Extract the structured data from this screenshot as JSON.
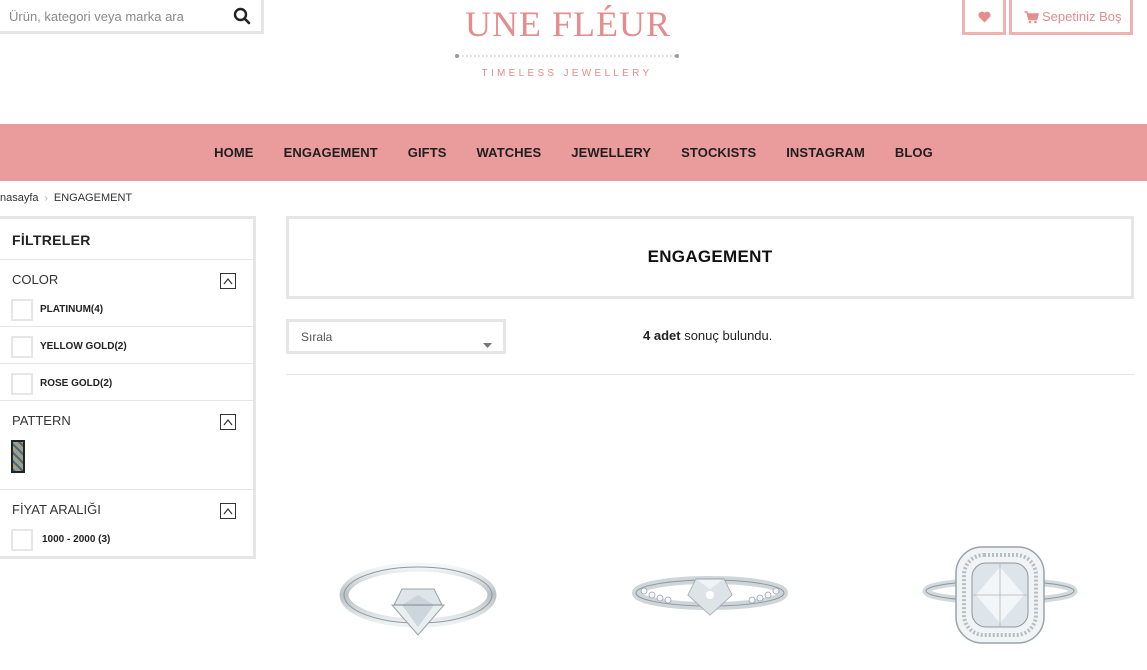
{
  "search": {
    "placeholder": "Ürün, kategori veya marka ara"
  },
  "brand": {
    "name": "UNE FLÉUR",
    "tagline": "TIMELESS JEWELLERY",
    "color": "#e48c8e"
  },
  "header": {
    "wishlist_icon": "heart-icon",
    "cart_label": "Sepetiniz Boş",
    "cart_icon": "cart-icon"
  },
  "nav": {
    "color": "#ea9c9c",
    "items": [
      "HOME",
      "ENGAGEMENT",
      "GIFTS",
      "WATCHES",
      "JEWELLERY",
      "STOCKISTS",
      "INSTAGRAM",
      "BLOG"
    ]
  },
  "breadcrumb": {
    "home": "nasayfa",
    "current": "ENGAGEMENT"
  },
  "filters": {
    "title": "FİLTRELER",
    "color": {
      "label": "COLOR",
      "options": [
        "PLATINUM(4)",
        "YELLOW GOLD(2)",
        "ROSE GOLD(2)"
      ]
    },
    "pattern": {
      "label": "PATTERN"
    },
    "price": {
      "label": "FİYAT ARALIĞI",
      "options": [
        "1000 - 2000 (3)"
      ]
    }
  },
  "category": {
    "title": "ENGAGEMENT"
  },
  "sort": {
    "label": "Sırala"
  },
  "results": {
    "count": "4 adet",
    "text": " sonuç bulundu."
  },
  "products": [
    {
      "image": "solitaire-ring-image"
    },
    {
      "image": "channel-set-ring-image"
    },
    {
      "image": "halo-cushion-ring-image"
    }
  ]
}
